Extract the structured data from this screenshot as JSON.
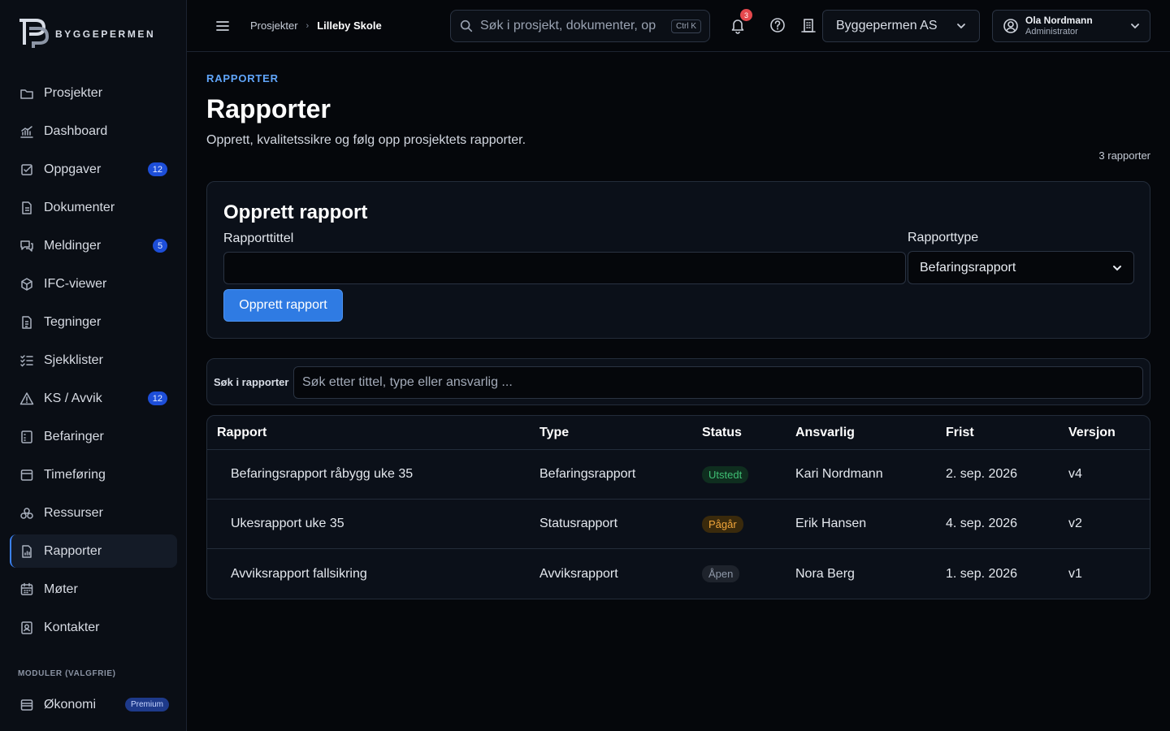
{
  "app": {
    "logo_text": "BYGGEPERMEN"
  },
  "sidebar": {
    "items": [
      {
        "label": "Prosjekter",
        "icon": "folder-icon"
      },
      {
        "label": "Dashboard",
        "icon": "chart-icon"
      },
      {
        "label": "Oppgaver",
        "icon": "checkbox-icon",
        "badge": "12"
      },
      {
        "label": "Dokumenter",
        "icon": "document-icon"
      },
      {
        "label": "Meldinger",
        "icon": "messages-icon",
        "badge": "5"
      },
      {
        "label": "IFC-viewer",
        "icon": "cube-icon"
      },
      {
        "label": "Tegninger",
        "icon": "drawing-icon"
      },
      {
        "label": "Sjekklister",
        "icon": "checklist-icon"
      },
      {
        "label": "KS / Avvik",
        "icon": "warning-icon",
        "badge": "12"
      },
      {
        "label": "Befaringer",
        "icon": "inspection-icon"
      },
      {
        "label": "Timeføring",
        "icon": "calendar-icon"
      },
      {
        "label": "Ressurser",
        "icon": "resources-icon"
      },
      {
        "label": "Rapporter",
        "icon": "report-icon",
        "active": true
      },
      {
        "label": "Møter",
        "icon": "meeting-icon"
      },
      {
        "label": "Kontakter",
        "icon": "contact-icon"
      }
    ],
    "modules_label": "MODULER (VALGFRIE)",
    "modules": [
      {
        "label": "Økonomi",
        "icon": "wallet-icon",
        "badge": "Premium"
      }
    ]
  },
  "header": {
    "breadcrumb": [
      "Prosjekter",
      "Lilleby Skole"
    ],
    "search_placeholder": "Søk i prosjekt, dokumenter, oppgaver",
    "search_shortcut": "Ctrl K",
    "notification_count": "3",
    "org": "Byggepermen AS",
    "user_name": "Ola Nordmann",
    "user_role": "Administrator"
  },
  "main": {
    "eyebrow": "RAPPORTER",
    "title": "Rapporter",
    "subtitle": "Opprett, kvalitetssikre og følg opp prosjektets rapporter.",
    "count": "3 rapporter",
    "create": {
      "title": "Opprett rapport",
      "title_label": "Rapporttittel",
      "title_value": "",
      "type_label": "Rapporttype",
      "type_value": "Befaringsrapport",
      "button": "Opprett rapport"
    },
    "filter": {
      "label": "Søk i rapporter",
      "placeholder": "Søk etter tittel, type eller ansvarlig ..."
    },
    "table": {
      "columns": [
        "Rapport",
        "Type",
        "Status",
        "Ansvarlig",
        "Frist",
        "Versjon"
      ],
      "rows": [
        {
          "rapport": "Befaringsrapport råbygg uke 35",
          "type": "Befaringsrapport",
          "status": "Utstedt",
          "ansvarlig": "Kari Nordmann",
          "frist": "2. sep. 2026",
          "versjon": "v4"
        },
        {
          "rapport": "Ukesrapport uke 35",
          "type": "Statusrapport",
          "status": "Pågår",
          "ansvarlig": "Erik Hansen",
          "frist": "4. sep. 2026",
          "versjon": "v2"
        },
        {
          "rapport": "Avviksrapport fallsikring",
          "type": "Avviksrapport",
          "status": "Åpen",
          "ansvarlig": "Nora Berg",
          "frist": "1. sep. 2026",
          "versjon": "v1"
        }
      ]
    },
    "status_colors": {
      "Utstedt": {
        "bg": "#0f2e1f",
        "fg": "#3fbf74"
      },
      "Pågår": {
        "bg": "#3a2a0c",
        "fg": "#f0a53a"
      },
      "Åpen": {
        "bg": "#1e232c",
        "fg": "#8f98a8"
      }
    },
    "accent": "#3b82f6"
  }
}
